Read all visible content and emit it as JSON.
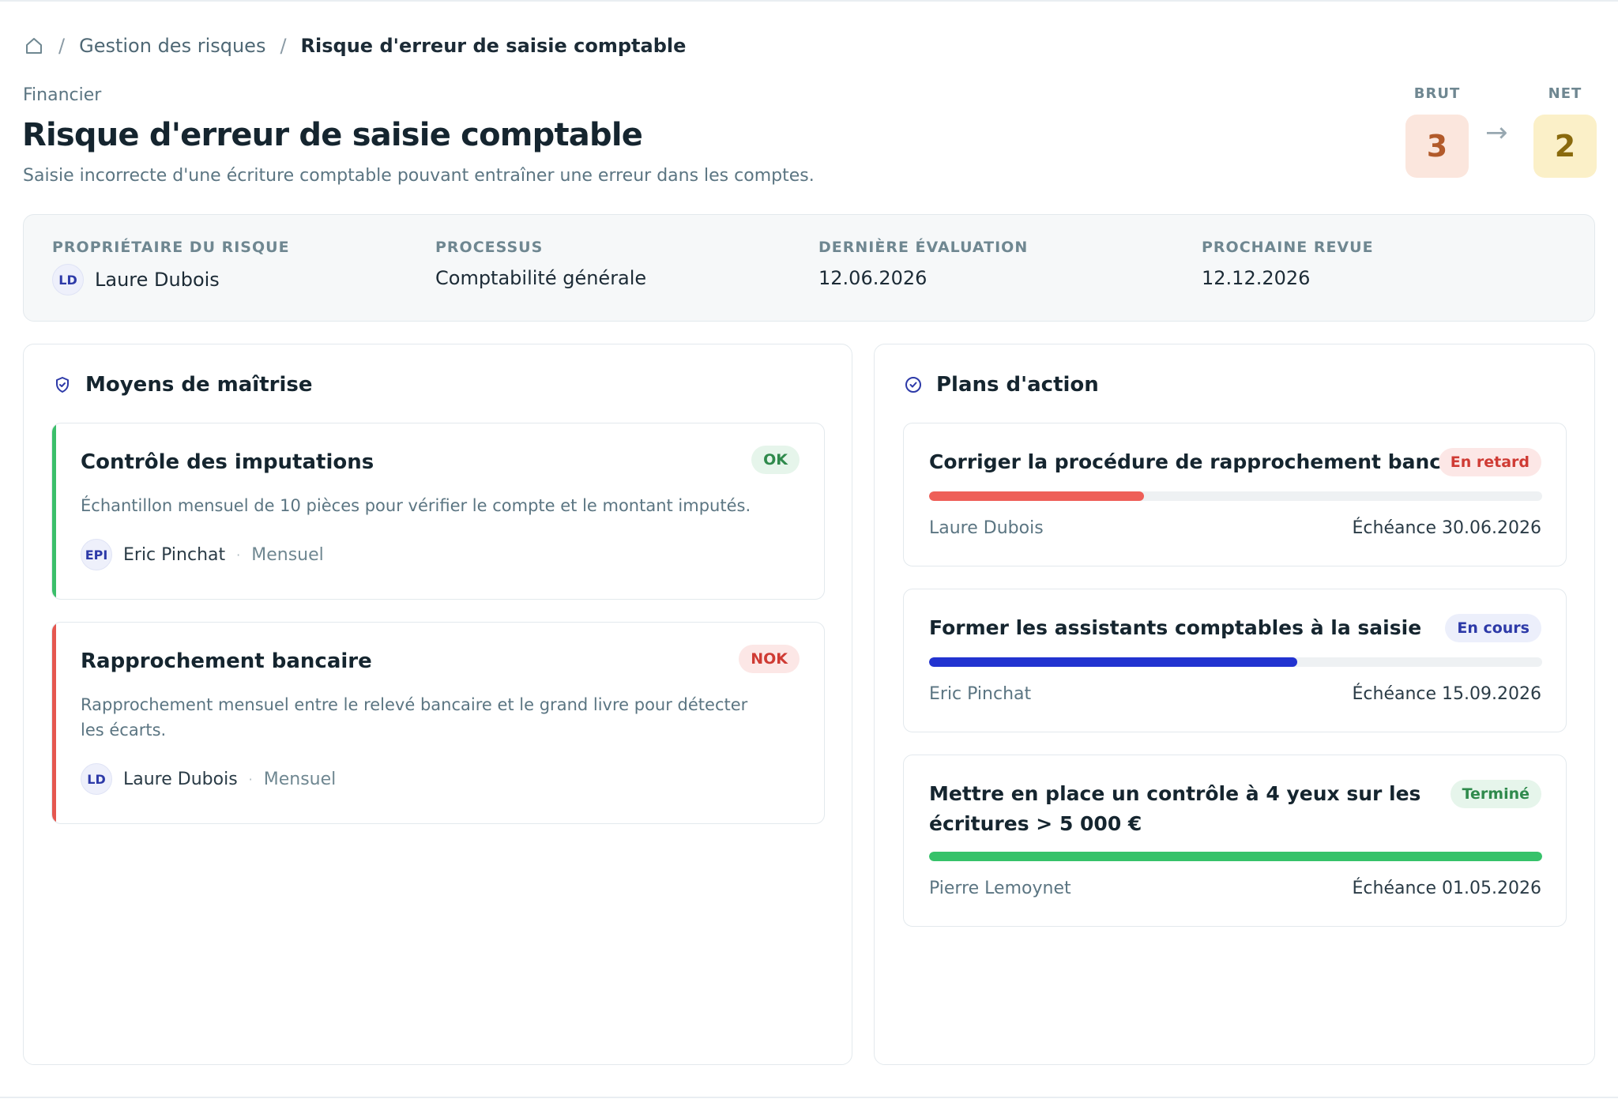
{
  "breadcrumb": {
    "home_icon": "home-icon",
    "separator": "/",
    "parent": "Gestion des risques",
    "current": "Risque d'erreur de saisie comptable"
  },
  "header": {
    "category": "Financier",
    "title": "Risque d'erreur de saisie comptable",
    "description": "Saisie incorrecte d'une écriture comptable pouvant entraîner une erreur dans les comptes."
  },
  "scores": {
    "brut_label": "BRUT",
    "brut_value": "3",
    "net_label": "NET",
    "net_value": "2",
    "arrow": "→"
  },
  "meta": {
    "owner_label": "PROPRIÉTAIRE DU RISQUE",
    "owner_initials": "LD",
    "owner_name": "Laure Dubois",
    "process_label": "PROCESSUS",
    "process_value": "Comptabilité générale",
    "last_eval_label": "DERNIÈRE ÉVALUATION",
    "last_eval_value": "12.06.2026",
    "next_review_label": "PROCHAINE REVUE",
    "next_review_value": "12.12.2026"
  },
  "controls": {
    "title": "Moyens de maîtrise",
    "icon": "shield-check-icon",
    "items": [
      {
        "title": "Contrôle des imputations",
        "status": "OK",
        "description": "Échantillon mensuel de 10 pièces pour vérifier le compte et le montant imputés.",
        "owner_initials": "EPI",
        "owner": "Eric Pinchat",
        "separator": "·",
        "frequency": "Mensuel",
        "accent": "#3bbf6a"
      },
      {
        "title": "Rapprochement bancaire",
        "status": "NOK",
        "description": "Rapprochement mensuel entre le relevé bancaire et le grand livre pour détecter les écarts.",
        "owner_initials": "LD",
        "owner": "Laure Dubois",
        "separator": "·",
        "frequency": "Mensuel",
        "accent": "#e5574f"
      }
    ]
  },
  "actions": {
    "title": "Plans d'action",
    "icon": "check-circle-icon",
    "items": [
      {
        "title": "Corriger la procédure de rapprochement bancaire",
        "status": "En retard",
        "progress": 0.35,
        "color": "#ee5f58",
        "owner": "Laure Dubois",
        "due": "Échéance 30.06.2026"
      },
      {
        "title": "Former les assistants comptables à la saisie",
        "status": "En cours",
        "progress": 0.6,
        "color": "#2233d0",
        "owner": "Eric Pinchat",
        "due": "Échéance 15.09.2026"
      },
      {
        "title": "Mettre en place un contrôle à 4 yeux sur les écritures > 5 000 €",
        "status": "Terminé",
        "progress": 1.0,
        "color": "#36c26a",
        "owner": "Pierre Lemoynet",
        "due": "Échéance 01.05.2026"
      }
    ]
  }
}
